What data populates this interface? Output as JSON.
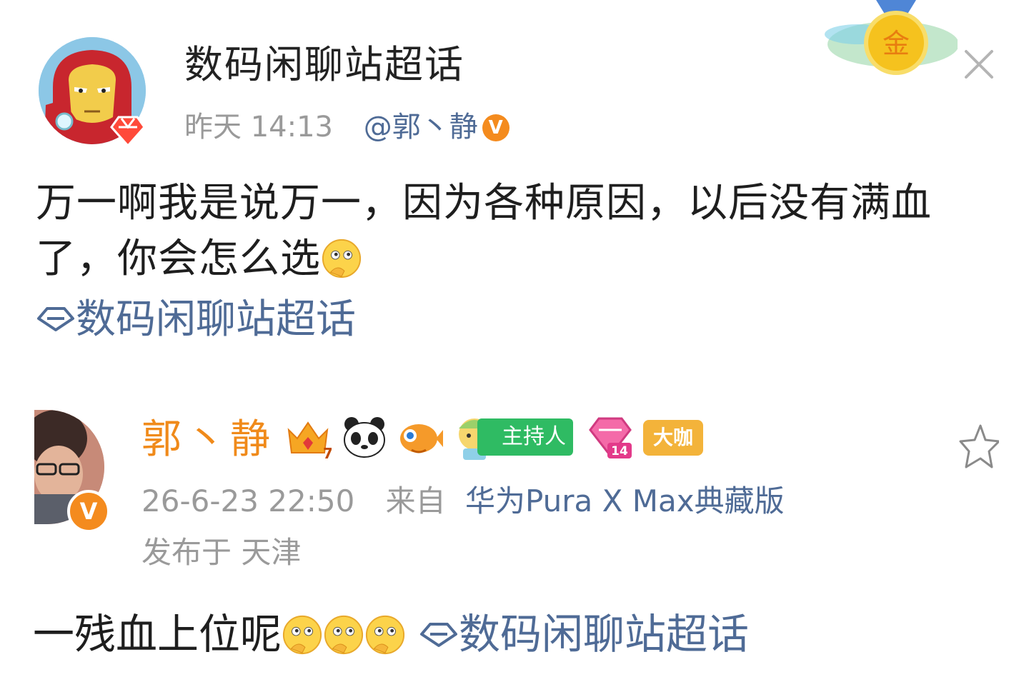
{
  "post": {
    "supertopic_title": "数码闲聊站超话",
    "time": "昨天 14:13",
    "mention": "@郭丶静",
    "verified_badge": "V",
    "body_line1": "万一啊我是说万一，因为各种原因，以后没有满血",
    "body_line2": "了，你会怎么选",
    "topic_link": "数码闲聊站超话",
    "medal_label": "金"
  },
  "comment": {
    "author": "郭丶静",
    "verified_badge": "V",
    "host_badge": "主持人",
    "level_badge": "14",
    "crown_badge": "7",
    "daka_badge": "大咖",
    "datetime": "26-6-23 22:50",
    "from_label": "来自",
    "device": "华为Pura X Max典藏版",
    "location": "发布于 天津",
    "text": "一残血上位呢",
    "topic_link": "数码闲聊站超话"
  },
  "colors": {
    "link": "#4f6b96",
    "name_orange": "#f08a1a",
    "verified": "#f48b1e",
    "meta_gray": "#9a9a9a",
    "host_green": "#2fbb63",
    "daka_yellow": "#f3b33a"
  },
  "icons": [
    "diamond-badge-icon",
    "gold-medal-icon",
    "close-icon",
    "thinking-emoji-icon",
    "supertopic-diamond-icon",
    "crown-icon",
    "panda-icon",
    "fish-icon",
    "host-character-icon",
    "level-diamond-icon",
    "star-icon"
  ]
}
